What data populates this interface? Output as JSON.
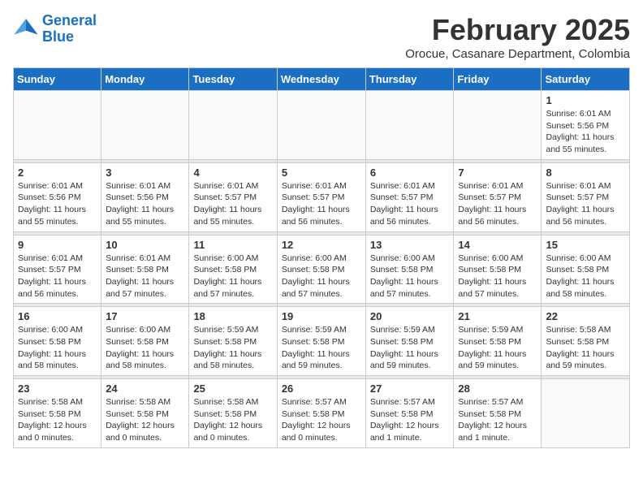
{
  "logo": {
    "line1": "General",
    "line2": "Blue"
  },
  "title": "February 2025",
  "subtitle": "Orocue, Casanare Department, Colombia",
  "days_of_week": [
    "Sunday",
    "Monday",
    "Tuesday",
    "Wednesday",
    "Thursday",
    "Friday",
    "Saturday"
  ],
  "weeks": [
    [
      {
        "day": "",
        "info": ""
      },
      {
        "day": "",
        "info": ""
      },
      {
        "day": "",
        "info": ""
      },
      {
        "day": "",
        "info": ""
      },
      {
        "day": "",
        "info": ""
      },
      {
        "day": "",
        "info": ""
      },
      {
        "day": "1",
        "info": "Sunrise: 6:01 AM\nSunset: 5:56 PM\nDaylight: 11 hours\nand 55 minutes."
      }
    ],
    [
      {
        "day": "2",
        "info": "Sunrise: 6:01 AM\nSunset: 5:56 PM\nDaylight: 11 hours\nand 55 minutes."
      },
      {
        "day": "3",
        "info": "Sunrise: 6:01 AM\nSunset: 5:56 PM\nDaylight: 11 hours\nand 55 minutes."
      },
      {
        "day": "4",
        "info": "Sunrise: 6:01 AM\nSunset: 5:57 PM\nDaylight: 11 hours\nand 55 minutes."
      },
      {
        "day": "5",
        "info": "Sunrise: 6:01 AM\nSunset: 5:57 PM\nDaylight: 11 hours\nand 56 minutes."
      },
      {
        "day": "6",
        "info": "Sunrise: 6:01 AM\nSunset: 5:57 PM\nDaylight: 11 hours\nand 56 minutes."
      },
      {
        "day": "7",
        "info": "Sunrise: 6:01 AM\nSunset: 5:57 PM\nDaylight: 11 hours\nand 56 minutes."
      },
      {
        "day": "8",
        "info": "Sunrise: 6:01 AM\nSunset: 5:57 PM\nDaylight: 11 hours\nand 56 minutes."
      }
    ],
    [
      {
        "day": "9",
        "info": "Sunrise: 6:01 AM\nSunset: 5:57 PM\nDaylight: 11 hours\nand 56 minutes."
      },
      {
        "day": "10",
        "info": "Sunrise: 6:01 AM\nSunset: 5:58 PM\nDaylight: 11 hours\nand 57 minutes."
      },
      {
        "day": "11",
        "info": "Sunrise: 6:00 AM\nSunset: 5:58 PM\nDaylight: 11 hours\nand 57 minutes."
      },
      {
        "day": "12",
        "info": "Sunrise: 6:00 AM\nSunset: 5:58 PM\nDaylight: 11 hours\nand 57 minutes."
      },
      {
        "day": "13",
        "info": "Sunrise: 6:00 AM\nSunset: 5:58 PM\nDaylight: 11 hours\nand 57 minutes."
      },
      {
        "day": "14",
        "info": "Sunrise: 6:00 AM\nSunset: 5:58 PM\nDaylight: 11 hours\nand 57 minutes."
      },
      {
        "day": "15",
        "info": "Sunrise: 6:00 AM\nSunset: 5:58 PM\nDaylight: 11 hours\nand 58 minutes."
      }
    ],
    [
      {
        "day": "16",
        "info": "Sunrise: 6:00 AM\nSunset: 5:58 PM\nDaylight: 11 hours\nand 58 minutes."
      },
      {
        "day": "17",
        "info": "Sunrise: 6:00 AM\nSunset: 5:58 PM\nDaylight: 11 hours\nand 58 minutes."
      },
      {
        "day": "18",
        "info": "Sunrise: 5:59 AM\nSunset: 5:58 PM\nDaylight: 11 hours\nand 58 minutes."
      },
      {
        "day": "19",
        "info": "Sunrise: 5:59 AM\nSunset: 5:58 PM\nDaylight: 11 hours\nand 59 minutes."
      },
      {
        "day": "20",
        "info": "Sunrise: 5:59 AM\nSunset: 5:58 PM\nDaylight: 11 hours\nand 59 minutes."
      },
      {
        "day": "21",
        "info": "Sunrise: 5:59 AM\nSunset: 5:58 PM\nDaylight: 11 hours\nand 59 minutes."
      },
      {
        "day": "22",
        "info": "Sunrise: 5:58 AM\nSunset: 5:58 PM\nDaylight: 11 hours\nand 59 minutes."
      }
    ],
    [
      {
        "day": "23",
        "info": "Sunrise: 5:58 AM\nSunset: 5:58 PM\nDaylight: 12 hours\nand 0 minutes."
      },
      {
        "day": "24",
        "info": "Sunrise: 5:58 AM\nSunset: 5:58 PM\nDaylight: 12 hours\nand 0 minutes."
      },
      {
        "day": "25",
        "info": "Sunrise: 5:58 AM\nSunset: 5:58 PM\nDaylight: 12 hours\nand 0 minutes."
      },
      {
        "day": "26",
        "info": "Sunrise: 5:57 AM\nSunset: 5:58 PM\nDaylight: 12 hours\nand 0 minutes."
      },
      {
        "day": "27",
        "info": "Sunrise: 5:57 AM\nSunset: 5:58 PM\nDaylight: 12 hours\nand 1 minute."
      },
      {
        "day": "28",
        "info": "Sunrise: 5:57 AM\nSunset: 5:58 PM\nDaylight: 12 hours\nand 1 minute."
      },
      {
        "day": "",
        "info": ""
      }
    ]
  ]
}
